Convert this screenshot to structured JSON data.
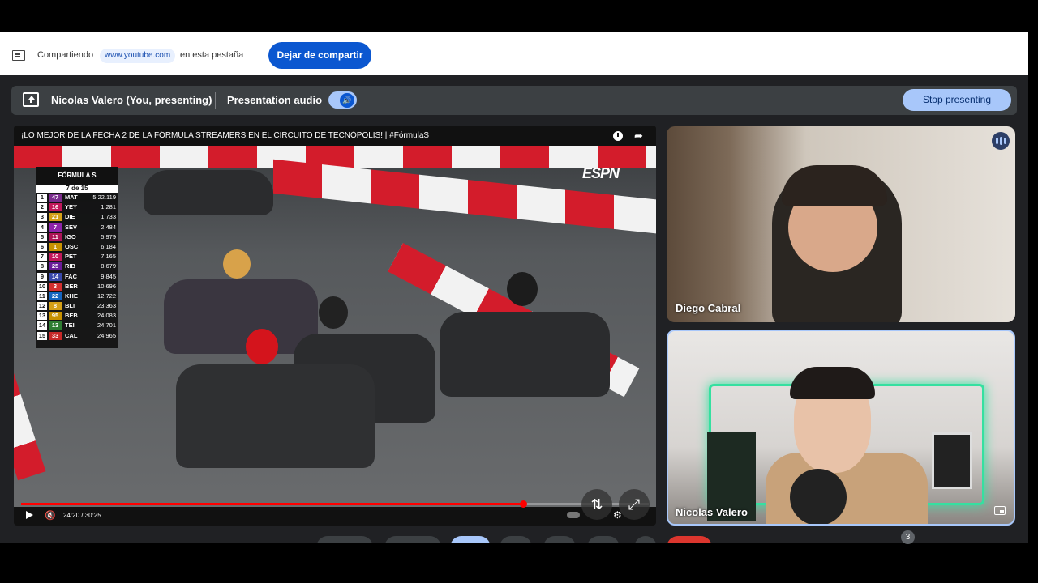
{
  "share_bar": {
    "prefix": "Compartiendo",
    "url": "www.youtube.com",
    "suffix": "en esta pestaña",
    "stop_sharing_label": "Dejar de compartir"
  },
  "presentation_bar": {
    "presenter": "Nicolas Valero (You, presenting)",
    "audio_label": "Presentation audio",
    "audio_enabled": true,
    "stop_label": "Stop presenting"
  },
  "video": {
    "title": "¡LO MEJOR DE LA FECHA 2 DE LA FÓRMULA STREAMERS EN EL CIRCUITO DE TECNÓPOLIS! | #FórmulaS",
    "time": "24:20 / 30:25",
    "progress": 0.8,
    "broadcaster": "ESPN",
    "standings": {
      "series": "FÓRMULA S",
      "lap": "7 de 15",
      "rows": [
        {
          "pos": "1",
          "num": "47",
          "code": "MAT",
          "time": "5:22.119",
          "color": "#7b2d8e"
        },
        {
          "pos": "2",
          "num": "16",
          "code": "YEY",
          "time": "1.281",
          "color": "#c2185b"
        },
        {
          "pos": "3",
          "num": "21",
          "code": "DIE",
          "time": "1.733",
          "color": "#d4a017"
        },
        {
          "pos": "4",
          "num": "7",
          "code": "SEV",
          "time": "2.484",
          "color": "#8e24aa"
        },
        {
          "pos": "5",
          "num": "11",
          "code": "IGO",
          "time": "5.979",
          "color": "#ad1457"
        },
        {
          "pos": "6",
          "num": "1",
          "code": "OSC",
          "time": "6.184",
          "color": "#c79100"
        },
        {
          "pos": "7",
          "num": "10",
          "code": "PET",
          "time": "7.165",
          "color": "#c2185b"
        },
        {
          "pos": "8",
          "num": "25",
          "code": "RIB",
          "time": "8.679",
          "color": "#6a1b9a"
        },
        {
          "pos": "9",
          "num": "14",
          "code": "FAC",
          "time": "9.845",
          "color": "#3949ab"
        },
        {
          "pos": "10",
          "num": "3",
          "code": "BER",
          "time": "10.696",
          "color": "#d32f2f"
        },
        {
          "pos": "11",
          "num": "22",
          "code": "KHE",
          "time": "12.722",
          "color": "#1565c0"
        },
        {
          "pos": "12",
          "num": "8",
          "code": "BLI",
          "time": "23.363",
          "color": "#d4a017"
        },
        {
          "pos": "13",
          "num": "95",
          "code": "BEB",
          "time": "24.083",
          "color": "#c79100"
        },
        {
          "pos": "14",
          "num": "13",
          "code": "TEI",
          "time": "24.701",
          "color": "#2e7d32"
        },
        {
          "pos": "15",
          "num": "33",
          "code": "CAL",
          "time": "24.965",
          "color": "#c62828"
        }
      ]
    }
  },
  "participants": [
    {
      "name": "Diego Cabral",
      "speaking": true
    },
    {
      "name": "Nicolas Valero",
      "speaking": false
    }
  ],
  "people_count": "3",
  "colors": {
    "meet_bg": "#202124",
    "accent": "#0b57d0",
    "accent_light": "#a8c7fa",
    "progress": "#ff0000"
  }
}
